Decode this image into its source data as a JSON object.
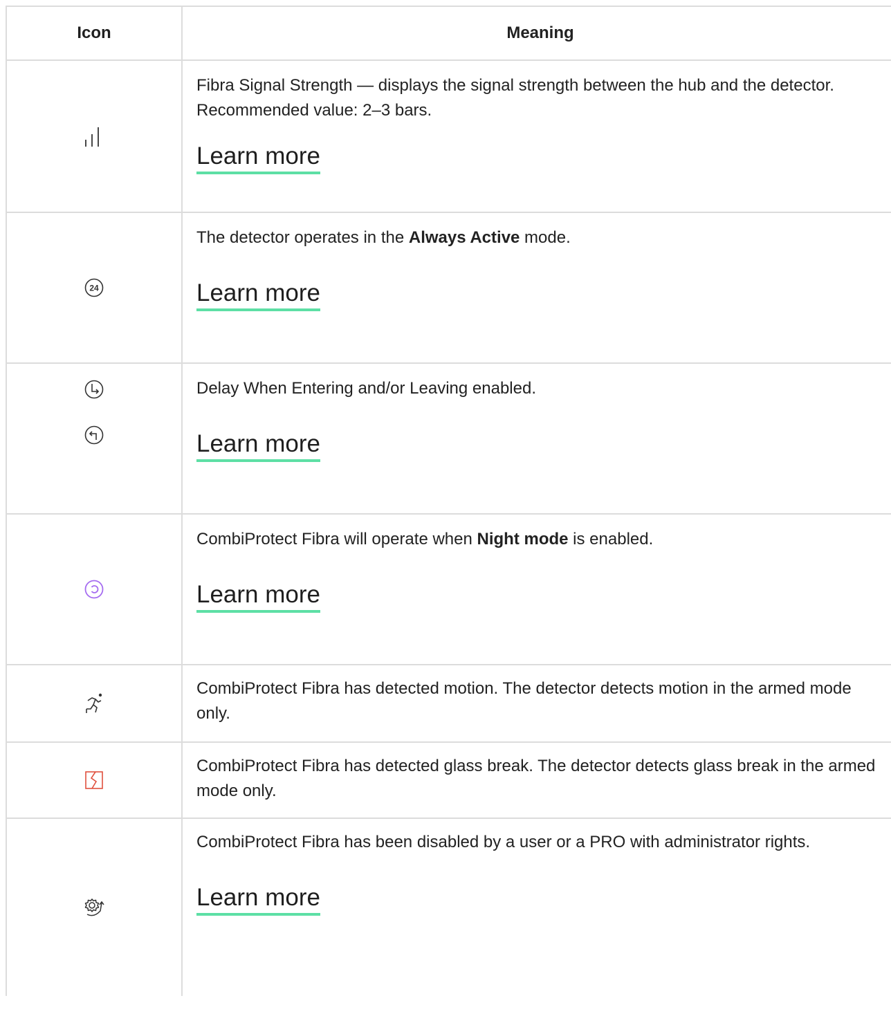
{
  "header": {
    "icon": "Icon",
    "meaning": "Meaning"
  },
  "rows": [
    {
      "icon": "signal-strength-icon",
      "desc": "Fibra Signal Strength — displays the signal strength between the hub and the detector. Recommended value: 2–3 bars.",
      "link": "Learn more"
    },
    {
      "icon": "always-active-icon",
      "icon_text": "24",
      "desc_pre": "The detector operates in the ",
      "desc_bold": "Always Active",
      "desc_post": " mode.",
      "link": "Learn more"
    },
    {
      "icon": "entry-exit-delay-icon",
      "desc": "Delay When Entering and/or Leaving enabled.",
      "link": "Learn more"
    },
    {
      "icon": "night-mode-icon",
      "icon_color": "#a56cf0",
      "desc_pre": "CombiProtect Fibra will operate when ",
      "desc_bold": "Night mode",
      "desc_post": " is enabled.",
      "link": "Learn more"
    },
    {
      "icon": "motion-detected-icon",
      "desc": "CombiProtect Fibra has detected motion. The detector detects motion in the armed mode only."
    },
    {
      "icon": "glass-break-icon",
      "icon_color": "#e0503e",
      "desc": "CombiProtect Fibra has detected glass break. The detector detects glass break in the armed mode only."
    },
    {
      "icon": "device-disabled-icon",
      "desc": "CombiProtect Fibra has been disabled by a user or a PRO with administrator rights.",
      "link": "Learn more"
    }
  ],
  "colors": {
    "border": "#dcdcdc",
    "link_underline": "#5ddfa5"
  }
}
